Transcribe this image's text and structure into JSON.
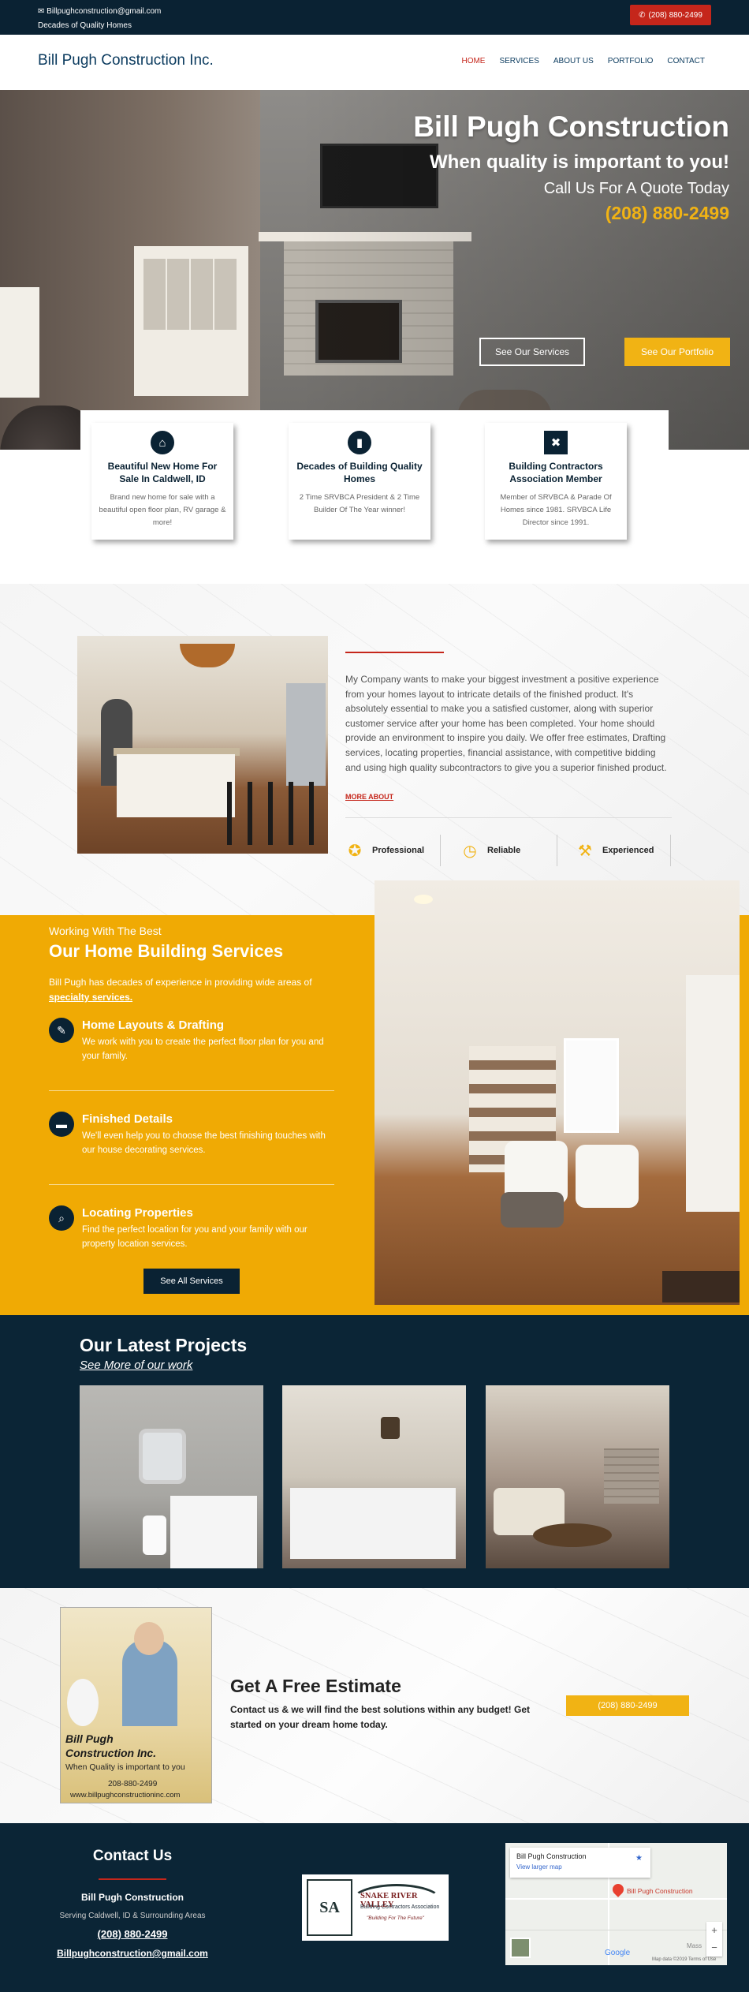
{
  "topbar": {
    "email": "Billpughconstruction@gmail.com",
    "tagline": "Decades of Quality Homes",
    "call_button": "(208) 880-2499",
    "email_icon": "envelope-icon",
    "phone_icon": "phone-icon"
  },
  "header": {
    "brand": "Bill Pugh Construction Inc.",
    "nav": [
      {
        "label": "HOME",
        "active": true
      },
      {
        "label": "SERVICES",
        "active": false
      },
      {
        "label": "ABOUT US",
        "active": false
      },
      {
        "label": "PORTFOLIO",
        "active": false
      },
      {
        "label": "CONTACT",
        "active": false
      }
    ]
  },
  "hero": {
    "title": "Bill Pugh Construction",
    "subtitle": "When quality is important to you!",
    "call_text": "Call Us For A Quote Today",
    "phone": "(208) 880-2499",
    "btn_services": "See Our Services",
    "btn_portfolio": "See Our Portfolio"
  },
  "features": [
    {
      "icon": "home-icon",
      "title": "Beautiful New Home For Sale In Caldwell, ID",
      "text": "Brand new home for sale with a beautiful open floor plan, RV garage & more!"
    },
    {
      "icon": "bookmark-icon",
      "title": "Decades of Building Quality Homes",
      "text": "2 Time SRVBCA President & 2 Time Builder Of The Year winner!"
    },
    {
      "icon": "tools-icon",
      "title": "Building Contractors Association Member",
      "text": "Member of SRVBCA & Parade Of Homes since 1981. SRVBCA Life Director since 1991."
    }
  ],
  "about": {
    "text": "My Company wants to make your biggest investment a positive experience from your homes layout to intricate details of the finished product. It's absolutely essential to make you a satisfied customer, along with superior customer service after your home has been completed. Your home should provide an environment to inspire you daily. We offer free estimates, Drafting services, locating properties, financial assistance, with competitive bidding and using high quality subcontractors to give you a superior finished product.",
    "more": "MORE ABOUT",
    "highlights": [
      {
        "icon": "award-icon",
        "label": "Professional"
      },
      {
        "icon": "clock-icon",
        "label": "Reliable"
      },
      {
        "icon": "hammer-icon",
        "label": "Experienced"
      }
    ]
  },
  "services": {
    "eyebrow": "Working With The Best",
    "title": "Our Home Building Services",
    "intro": "Bill Pugh has decades of experience in providing wide areas of",
    "intro_link": "specialty services.",
    "items": [
      {
        "icon": "pencil-icon",
        "title": "Home Layouts & Drafting",
        "text": "We work with you to create the perfect floor plan for you and your family."
      },
      {
        "icon": "sofa-icon",
        "title": "Finished Details",
        "text": "We'll even help you to choose the best finishing touches with our house decorating services."
      },
      {
        "icon": "search-location-icon",
        "title": "Locating Properties",
        "text": "Find the perfect location for you and your family with our property location services."
      }
    ],
    "button": "See All Services"
  },
  "projects": {
    "title": "Our Latest Projects",
    "link": "See More of our work"
  },
  "estimate": {
    "owner_lines": [
      "Bill Pugh",
      "Construction Inc.",
      "When Quality is important to you",
      "208-880-2499",
      "www.billpughconstructioninc.com"
    ],
    "title": "Get A Free Estimate",
    "text": "Contact us & we will find the best solutions within any budget! Get started on your dream home today.",
    "button": "(208) 880-2499"
  },
  "footer": {
    "title": "Contact Us",
    "company": "Bill Pugh Construction",
    "area": "Serving Caldwell, ID & Surrounding Areas",
    "phone": "(208) 880-2499",
    "email": "Billpughconstruction@gmail.com",
    "logo": {
      "mark": "SA",
      "name": "SNAKE RIVER VALLEY",
      "org": "Building Contractors Association",
      "motto": "\"Building For The Future\""
    },
    "map": {
      "place": "Bill Pugh Construction",
      "view_larger": "View larger map",
      "pin_label": "Bill Pugh Construction",
      "google": "Google",
      "attribution": "Map data ©2019   Terms of Use",
      "town": "Mass"
    }
  },
  "colors": {
    "navy": "#0a2233",
    "gold": "#f0aa04",
    "red": "#c5261b"
  }
}
